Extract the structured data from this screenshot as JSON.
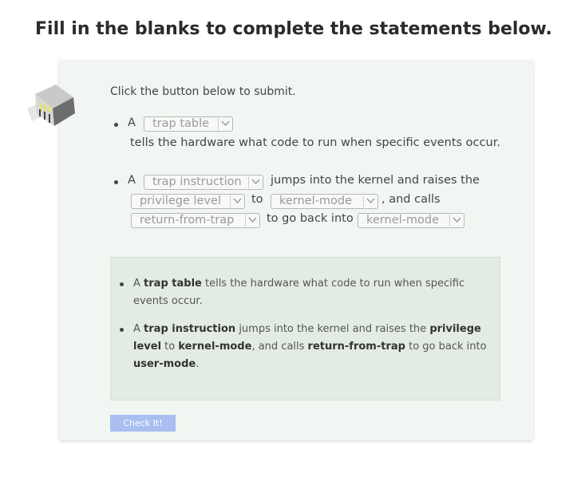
{
  "heading": "Fill in the blanks to complete the statements below.",
  "instruction": "Click the button below to submit.",
  "statement1": {
    "prefix": "A",
    "select_value": "trap table",
    "suffix": "tells the hardware what code to run when specific events occur."
  },
  "statement2": {
    "prefix": "A",
    "select1_value": "trap instruction",
    "text1": "jumps into the kernel and raises the",
    "select2_value": "privilege level",
    "text2": "to",
    "select3_value": "kernel-mode",
    "text3": ", and calls",
    "select4_value": "return-from-trap",
    "text4": "to go back into",
    "select5_value": "kernel-mode"
  },
  "answer": {
    "item1": {
      "prefix": "A",
      "bold1": "trap table",
      "rest": "tells the hardware what code to run when specific events occur."
    },
    "item2": {
      "prefix": "A",
      "bold1": "trap instruction",
      "text1": "jumps into the kernel and raises the",
      "bold2": "privilege level",
      "text2": "to",
      "bold3": "kernel-mode",
      "text3": ", and calls",
      "bold4": "return-from-trap",
      "text4": "to go back into",
      "bold5": "user-mode",
      "end": "."
    }
  },
  "check_button": "Check It!",
  "icons": {
    "illustration": "server-cube-icon",
    "dropdown": "chevron-down-icon"
  },
  "colors": {
    "card_bg": "#f2f6f2",
    "answer_bg": "#e3ece3",
    "button_bg": "#a8bff0"
  }
}
